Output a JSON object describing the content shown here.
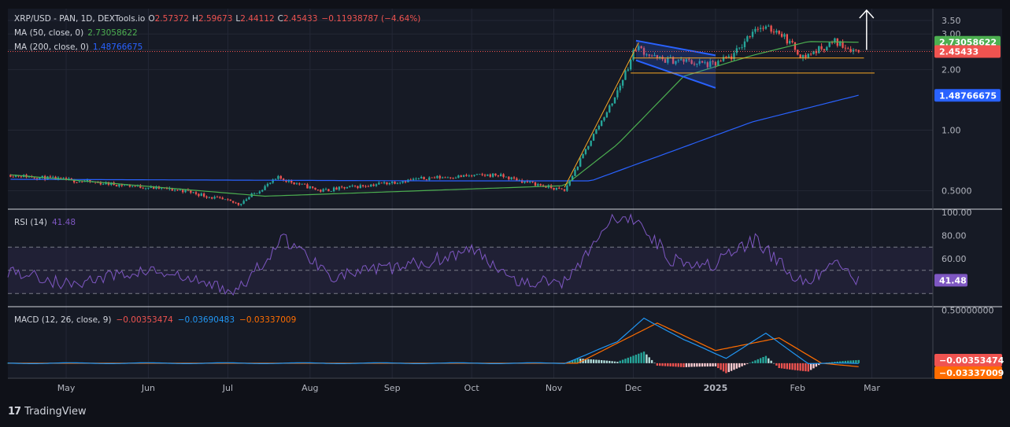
{
  "header": {
    "symbol": "XRP/USD - PAN, 1D, DEXTools.io",
    "o_label": "O",
    "o": "2.57372",
    "h_label": "H",
    "h": "2.59673",
    "l_label": "L",
    "l": "2.44112",
    "c_label": "C",
    "c": "2.45433",
    "change": "−0.11938787 (−4.64%)",
    "ma50_label": "MA (50, close, 0)",
    "ma50_value": "2.73058622",
    "ma200_label": "MA (200, close, 0)",
    "ma200_value": "1.48766675"
  },
  "rsi": {
    "label": "RSI (14)",
    "value": "41.48"
  },
  "macd": {
    "label": "MACD (12, 26, close, 9)",
    "macd_value": "−0.00353474",
    "signal_value": "−0.03690483",
    "hist_value": "−0.03337009"
  },
  "brand": {
    "name": "TradingView",
    "logo": "17"
  },
  "colors": {
    "up": "#26a69a",
    "down": "#ef5350",
    "ma50": "#4caf50",
    "ma200": "#2962ff",
    "rsi": "#7e57c2",
    "macd": "#2196f3",
    "signal": "#ff6d00",
    "channel": "#2962ff",
    "level": "#f9a825"
  },
  "chart_data": [
    {
      "type": "candlestick",
      "name": "price",
      "x_ticks": [
        "May",
        "Jun",
        "Jul",
        "Aug",
        "Sep",
        "Oct",
        "Nov",
        "Dec",
        "2025",
        "Feb",
        "Mar"
      ],
      "y_scale": "log",
      "y_ticks": [
        "3.50",
        "3.00",
        "2.50",
        "2.00",
        "1.00",
        "0.5000"
      ],
      "y_tick_values": [
        3.5,
        3.0,
        2.5,
        2.0,
        1.0,
        0.5
      ],
      "ylim": [
        0.42,
        3.9
      ],
      "last_price": "2.45433",
      "ma50_tag": "2.73058622",
      "ma200_tag": "1.48766675",
      "key_points": [
        {
          "date": "2024-04-10",
          "close": 0.6
        },
        {
          "date": "2024-06-15",
          "close": 0.5
        },
        {
          "date": "2024-07-05",
          "close": 0.43
        },
        {
          "date": "2024-07-20",
          "close": 0.58
        },
        {
          "date": "2024-08-05",
          "close": 0.5
        },
        {
          "date": "2024-09-15",
          "close": 0.58
        },
        {
          "date": "2024-10-10",
          "close": 0.6
        },
        {
          "date": "2024-11-05",
          "close": 0.5
        },
        {
          "date": "2024-11-16",
          "close": 0.95
        },
        {
          "date": "2024-11-24",
          "close": 1.45
        },
        {
          "date": "2024-12-02",
          "close": 2.6
        },
        {
          "date": "2024-12-10",
          "close": 2.25
        },
        {
          "date": "2024-12-20",
          "close": 2.2
        },
        {
          "date": "2024-12-31",
          "close": 2.1
        },
        {
          "date": "2025-01-08",
          "close": 2.35
        },
        {
          "date": "2025-01-16",
          "close": 3.25
        },
        {
          "date": "2025-01-25",
          "close": 3.1
        },
        {
          "date": "2025-02-03",
          "close": 2.3
        },
        {
          "date": "2025-02-15",
          "close": 2.75
        },
        {
          "date": "2025-02-24",
          "close": 2.45
        }
      ],
      "ma50_points": [
        {
          "date": "2024-04-10",
          "value": 0.6
        },
        {
          "date": "2024-07-15",
          "value": 0.47
        },
        {
          "date": "2024-11-05",
          "value": 0.53
        },
        {
          "date": "2024-11-25",
          "value": 0.85
        },
        {
          "date": "2024-12-20",
          "value": 1.85
        },
        {
          "date": "2025-01-15",
          "value": 2.35
        },
        {
          "date": "2025-02-05",
          "value": 2.75
        },
        {
          "date": "2025-02-24",
          "value": 2.73
        }
      ],
      "ma200_points": [
        {
          "date": "2024-04-10",
          "value": 0.57
        },
        {
          "date": "2024-09-15",
          "value": 0.56
        },
        {
          "date": "2024-11-15",
          "value": 0.56
        },
        {
          "date": "2024-12-15",
          "value": 0.78
        },
        {
          "date": "2025-01-15",
          "value": 1.1
        },
        {
          "date": "2025-02-24",
          "value": 1.49
        }
      ]
    },
    {
      "type": "line",
      "name": "RSI (14)",
      "y_ticks": [
        "100.00",
        "80.00",
        "60.00",
        "40.00"
      ],
      "y_tick_values": [
        100,
        80,
        60,
        40
      ],
      "ylim": [
        20,
        100
      ],
      "bands": [
        70,
        50,
        30
      ],
      "last_value": "41.48",
      "points": [
        {
          "date": "2024-04-10",
          "value": 50
        },
        {
          "date": "2024-05-01",
          "value": 38
        },
        {
          "date": "2024-06-01",
          "value": 50
        },
        {
          "date": "2024-07-05",
          "value": 32
        },
        {
          "date": "2024-07-22",
          "value": 78
        },
        {
          "date": "2024-08-10",
          "value": 45
        },
        {
          "date": "2024-09-10",
          "value": 55
        },
        {
          "date": "2024-10-01",
          "value": 68
        },
        {
          "date": "2024-10-20",
          "value": 40
        },
        {
          "date": "2024-11-05",
          "value": 40
        },
        {
          "date": "2024-11-22",
          "value": 92
        },
        {
          "date": "2024-12-02",
          "value": 95
        },
        {
          "date": "2024-12-15",
          "value": 60
        },
        {
          "date": "2024-12-31",
          "value": 55
        },
        {
          "date": "2025-01-16",
          "value": 76
        },
        {
          "date": "2025-02-03",
          "value": 38
        },
        {
          "date": "2025-02-15",
          "value": 55
        },
        {
          "date": "2025-02-24",
          "value": 41.48
        }
      ]
    },
    {
      "type": "macd",
      "name": "MACD (12, 26, close, 9)",
      "y_ticks": [
        "0.50000000"
      ],
      "y_tick_values": [
        0.5
      ],
      "ylim": [
        -0.12,
        0.52
      ],
      "macd_tag": "−0.00353474",
      "signal_tag": "−0.03337009",
      "macd_points": [
        {
          "date": "2024-04-10",
          "value": 0.0
        },
        {
          "date": "2024-11-05",
          "value": 0.0
        },
        {
          "date": "2024-11-25",
          "value": 0.2
        },
        {
          "date": "2024-12-05",
          "value": 0.43
        },
        {
          "date": "2024-12-20",
          "value": 0.22
        },
        {
          "date": "2025-01-05",
          "value": 0.05
        },
        {
          "date": "2025-01-20",
          "value": 0.28
        },
        {
          "date": "2025-02-05",
          "value": 0.0
        },
        {
          "date": "2025-02-24",
          "value": -0.004
        }
      ],
      "signal_points": [
        {
          "date": "2024-04-10",
          "value": 0.0
        },
        {
          "date": "2024-11-10",
          "value": 0.0
        },
        {
          "date": "2024-12-10",
          "value": 0.38
        },
        {
          "date": "2025-01-01",
          "value": 0.12
        },
        {
          "date": "2025-01-25",
          "value": 0.24
        },
        {
          "date": "2025-02-10",
          "value": 0.0
        },
        {
          "date": "2025-02-24",
          "value": -0.033
        }
      ]
    }
  ]
}
